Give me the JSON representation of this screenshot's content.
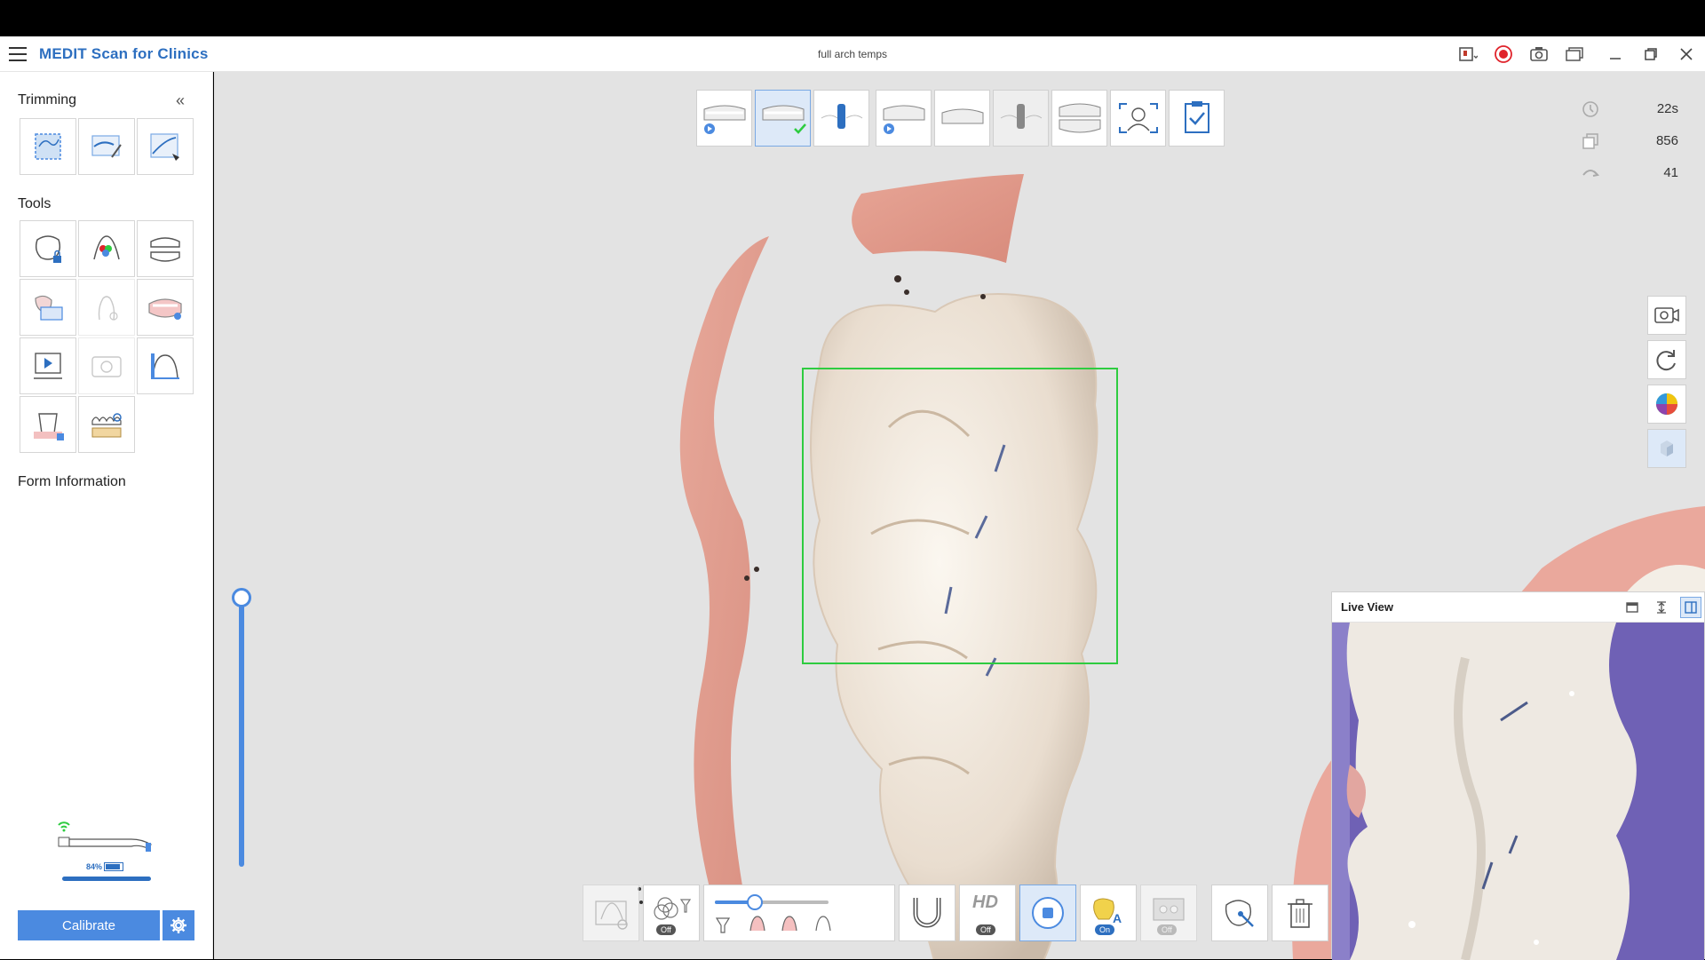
{
  "app": {
    "title": "MEDIT Scan for Clinics",
    "document_title": "full arch temps"
  },
  "sidebar": {
    "trimming_title": "Trimming",
    "tools_title": "Tools",
    "form_info_title": "Form Information",
    "battery_label": "84%",
    "calibrate_label": "Calibrate"
  },
  "stats": {
    "time": "22s",
    "frames": "856",
    "count": "41"
  },
  "live_view": {
    "title": "Live View"
  },
  "bottom_toggles": {
    "filter_off": "Off",
    "hd_label": "HD",
    "hd_off": "Off",
    "ai_on": "On",
    "record_off": "Off"
  },
  "colors": {
    "brand": "#2d6fc0",
    "accent": "#4b8ae0",
    "scan_box": "#2ecc40",
    "tooth": "#efe6dc",
    "gum": "#e8a79a",
    "record": "#e0232b"
  }
}
